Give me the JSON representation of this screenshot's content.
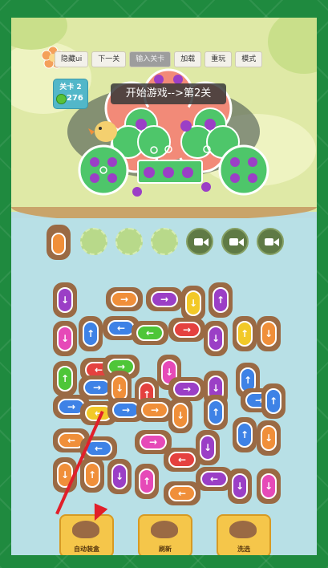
{
  "toolbar": {
    "buttons": [
      {
        "label": "隐藏ui"
      },
      {
        "label": "下一关"
      },
      {
        "label": "输入关卡"
      },
      {
        "label": "加载"
      },
      {
        "label": "重玩"
      },
      {
        "label": "模式"
      }
    ]
  },
  "level": {
    "label": "关卡 2",
    "coins": "276"
  },
  "banner": {
    "text": "开始游戏-->第2关"
  },
  "slots": {
    "filled": 1,
    "empty_pads": 3,
    "video_slots": 3
  },
  "bottom": {
    "auto_label": "自动装盒",
    "refresh_label": "刷新",
    "shuffle_label": "洗选"
  },
  "colors": {
    "purple": "#9b3fc6",
    "orange": "#f08f3a",
    "blue": "#3e82e6",
    "red": "#e5413f",
    "green": "#4ec638",
    "yellow": "#f2c928",
    "pink": "#e64ab8",
    "capybara": "#9a6a44"
  },
  "pieces": [
    {
      "c": "purple",
      "d": "down",
      "v": true
    },
    {
      "c": "orange",
      "d": "right",
      "v": false
    },
    {
      "c": "purple",
      "d": "right",
      "v": false
    },
    {
      "c": "yellow",
      "d": "down",
      "v": true
    },
    {
      "c": "purple",
      "d": "up",
      "v": true
    },
    {
      "c": "pink",
      "d": "down",
      "v": true
    },
    {
      "c": "blue",
      "d": "up",
      "v": true
    },
    {
      "c": "blue",
      "d": "left",
      "v": false
    },
    {
      "c": "green",
      "d": "left",
      "v": false
    },
    {
      "c": "red",
      "d": "right",
      "v": false
    },
    {
      "c": "purple",
      "d": "down",
      "v": true
    },
    {
      "c": "yellow",
      "d": "up",
      "v": true
    },
    {
      "c": "orange",
      "d": "down",
      "v": true
    },
    {
      "c": "red",
      "d": "left",
      "v": false
    },
    {
      "c": "green",
      "d": "right",
      "v": false
    },
    {
      "c": "pink",
      "d": "down",
      "v": true
    },
    {
      "c": "green",
      "d": "up",
      "v": true
    },
    {
      "c": "blue",
      "d": "up",
      "v": true
    },
    {
      "c": "blue",
      "d": "right",
      "v": false
    },
    {
      "c": "orange",
      "d": "down",
      "v": true
    },
    {
      "c": "red",
      "d": "up",
      "v": true
    },
    {
      "c": "purple",
      "d": "right",
      "v": false
    },
    {
      "c": "purple",
      "d": "down",
      "v": true
    },
    {
      "c": "blue",
      "d": "right",
      "v": false
    },
    {
      "c": "blue",
      "d": "up",
      "v": true
    },
    {
      "c": "blue",
      "d": "right",
      "v": false
    },
    {
      "c": "yellow",
      "d": "left",
      "v": false
    },
    {
      "c": "blue",
      "d": "right",
      "v": false
    },
    {
      "c": "orange",
      "d": "right",
      "v": false
    },
    {
      "c": "orange",
      "d": "down",
      "v": true
    },
    {
      "c": "blue",
      "d": "up",
      "v": true
    },
    {
      "c": "blue",
      "d": "up",
      "v": true
    },
    {
      "c": "orange",
      "d": "left",
      "v": false
    },
    {
      "c": "blue",
      "d": "left",
      "v": false
    },
    {
      "c": "pink",
      "d": "right",
      "v": false
    },
    {
      "c": "red",
      "d": "left",
      "v": false
    },
    {
      "c": "purple",
      "d": "down",
      "v": true
    },
    {
      "c": "orange",
      "d": "down",
      "v": true
    },
    {
      "c": "orange",
      "d": "down",
      "v": true
    },
    {
      "c": "orange",
      "d": "up",
      "v": true
    },
    {
      "c": "purple",
      "d": "down",
      "v": true
    },
    {
      "c": "pink",
      "d": "up",
      "v": true
    },
    {
      "c": "orange",
      "d": "left",
      "v": false
    },
    {
      "c": "purple",
      "d": "left",
      "v": false
    },
    {
      "c": "purple",
      "d": "down",
      "v": true
    },
    {
      "c": "pink",
      "d": "down",
      "v": true
    }
  ]
}
